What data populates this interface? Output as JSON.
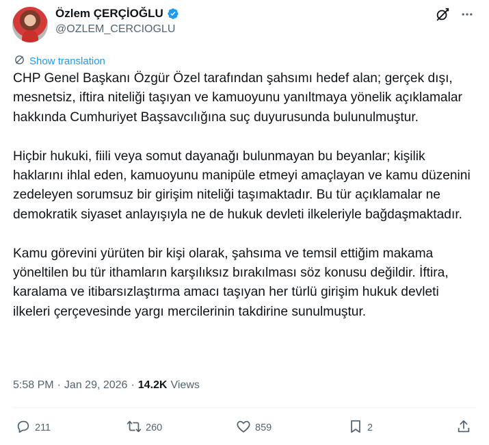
{
  "author": {
    "name": "Özlem ÇERÇİOĞLU",
    "handle": "@OZLEM_CERCIOGLU",
    "verified_icon": "verified-badge-icon",
    "accent_color": "#1d9bf0"
  },
  "header_actions": {
    "grok_icon": "grok-icon",
    "more_icon": "more-icon"
  },
  "translation": {
    "label": "Show translation"
  },
  "tweet": {
    "paragraphs": [
      "CHP Genel Başkanı Özgür Özel tarafından şahsımı hedef alan; gerçek dışı, mesnetsiz, iftira niteliği taşıyan ve kamuoyunu yanıltmaya yönelik açıklamalar hakkında Cumhuriyet Başsavcılığına suç duyurusunda bulunulmuştur.",
      "Hiçbir hukuki, fiili veya somut dayanağı bulunmayan bu beyanlar; kişilik haklarını ihlal eden, kamuoyunu manipüle etmeyi amaçlayan ve kamu düzenini zedeleyen sorumsuz bir girişim niteliği taşımaktadır. Bu tür açıklamalar ne demokratik siyaset anlayışıyla ne de hukuk devleti ilkeleriyle bağdaşmaktadır.",
      "Kamu görevini yürüten bir kişi olarak, şahsıma ve temsil ettiğim makama yöneltilen bu tür ithamların karşılıksız bırakılması söz konusu değildir. İftira, karalama ve itibarsızlaştırma amacı taşıyan her türlü girişim hukuk devleti ilkeleri çerçevesinde yargı mercilerinin takdirine sunulmuştur."
    ]
  },
  "meta": {
    "time": "5:58 PM",
    "separator": "·",
    "date": "Jan 29, 2026",
    "views_count": "14.2K",
    "views_label": "Views"
  },
  "actions": {
    "reply": {
      "icon": "reply-icon",
      "count": "211"
    },
    "retweet": {
      "icon": "retweet-icon",
      "count": "260"
    },
    "like": {
      "icon": "heart-icon",
      "count": "859"
    },
    "bookmark": {
      "icon": "bookmark-icon",
      "count": "2"
    },
    "share": {
      "icon": "share-icon"
    }
  }
}
